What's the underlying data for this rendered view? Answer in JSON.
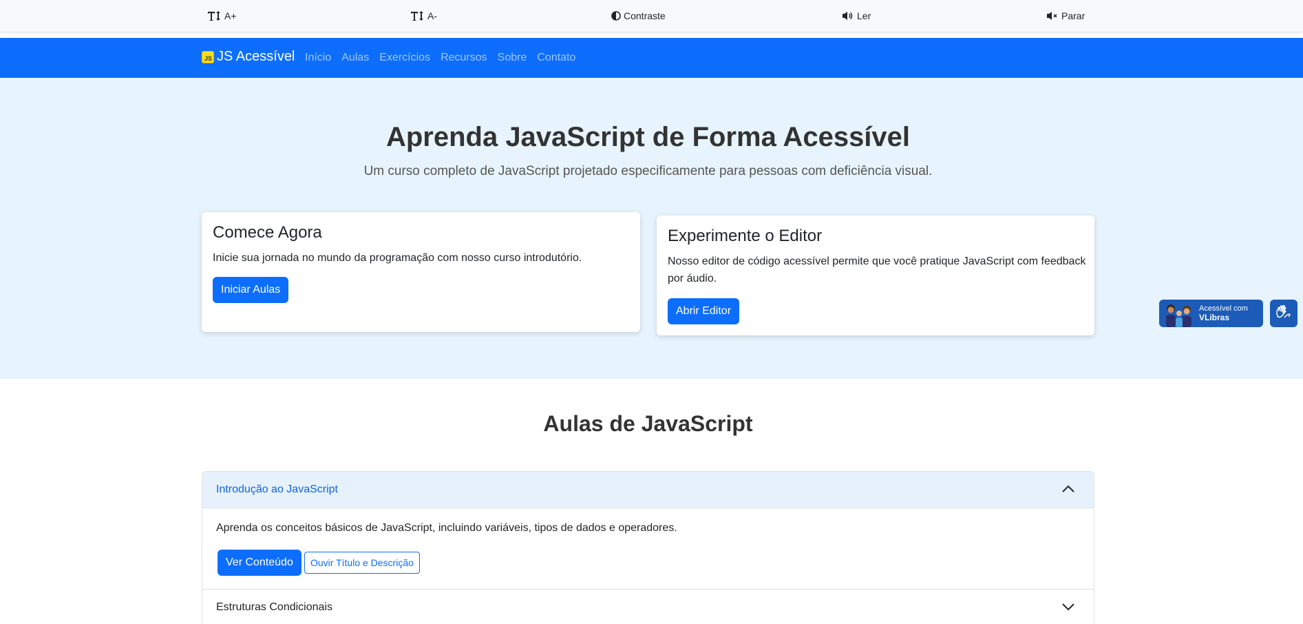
{
  "toolbar": {
    "increase_font": "A+",
    "decrease_font": "A-",
    "contrast": "Contraste",
    "read": "Ler",
    "stop": "Parar"
  },
  "navbar": {
    "logo_text": "JS",
    "brand": "JS Acessível",
    "links": [
      "Início",
      "Aulas",
      "Exercícios",
      "Recursos",
      "Sobre",
      "Contato"
    ]
  },
  "hero": {
    "title": "Aprenda JavaScript de Forma Acessível",
    "subtitle": "Um curso completo de JavaScript projetado especificamente para pessoas com deficiência visual.",
    "cards": [
      {
        "title": "Comece Agora",
        "text": "Inicie sua jornada no mundo da programação com nosso curso introdutório.",
        "button": "Iniciar Aulas"
      },
      {
        "title": "Experimente o Editor",
        "text": "Nosso editor de código acessível permite que você pratique JavaScript com feedback por áudio.",
        "button": "Abrir Editor"
      }
    ]
  },
  "vlibras": {
    "line1": "Acessível com",
    "line2": "VLibras"
  },
  "lessons": {
    "title": "Aulas de JavaScript",
    "items": [
      {
        "title": "Introdução ao JavaScript",
        "description": "Aprenda os conceitos básicos de JavaScript, incluindo variáveis, tipos de dados e operadores.",
        "view_button": "Ver Conteúdo",
        "listen_button": "Ouvir Título e Descrição",
        "expanded": true
      },
      {
        "title": "Estruturas Condicionais",
        "expanded": false
      }
    ]
  },
  "colors": {
    "primary": "#0d6efd",
    "hero_bg": "#e7f4fd",
    "toolbar_bg": "#f8f9fa",
    "accordion_active_bg": "#e7f1fc",
    "accordion_active_text": "#0c63e4",
    "vlibras_blue": "#1c5cb8"
  }
}
